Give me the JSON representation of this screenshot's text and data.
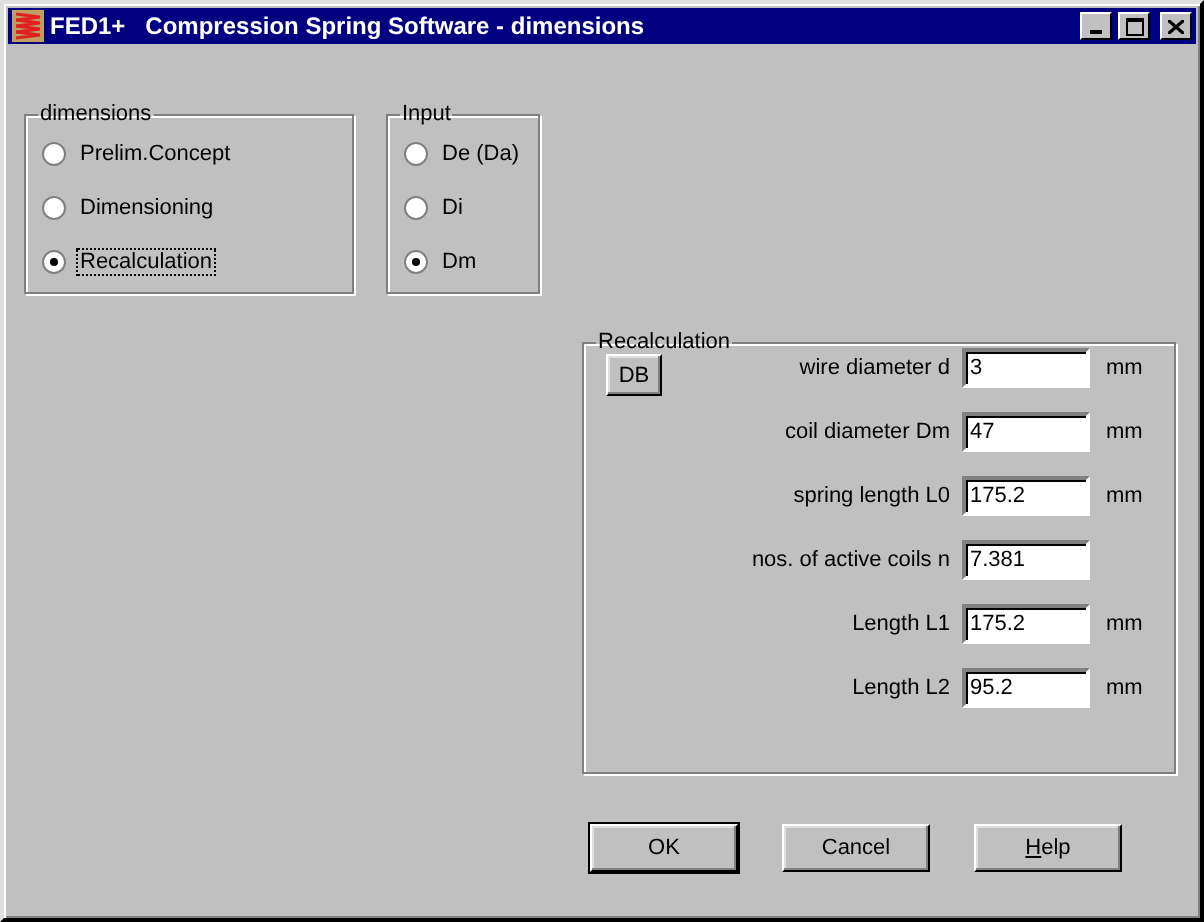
{
  "window": {
    "title": "FED1+   Compression Spring Software - dimensions"
  },
  "dimensions_group": {
    "title": "dimensions",
    "options": [
      {
        "label": "Prelim.Concept",
        "selected": false,
        "focused": false
      },
      {
        "label": "Dimensioning",
        "selected": false,
        "focused": false
      },
      {
        "label": "Recalculation",
        "selected": true,
        "focused": true
      }
    ]
  },
  "input_group": {
    "title": "Input",
    "options": [
      {
        "label": "De (Da)",
        "selected": false
      },
      {
        "label": "Di",
        "selected": false
      },
      {
        "label": "Dm",
        "selected": true
      }
    ]
  },
  "recalculation_group": {
    "title": "Recalculation",
    "db_button": "DB",
    "fields": [
      {
        "label": "wire diameter d",
        "value": "3",
        "unit": "mm"
      },
      {
        "label": "coil diameter Dm",
        "value": "47",
        "unit": "mm"
      },
      {
        "label": "spring length L0",
        "value": "175.2",
        "unit": "mm"
      },
      {
        "label": "nos. of active coils n",
        "value": "7.381"
      },
      {
        "label": "Length L1",
        "value": "175.2",
        "unit": "mm"
      },
      {
        "label": "Length L2",
        "value": "95.2",
        "unit": "mm"
      }
    ]
  },
  "buttons": [
    {
      "label": "OK",
      "default": true,
      "mnemonic": false
    },
    {
      "label": "Cancel",
      "default": false,
      "mnemonic": false
    },
    {
      "label": "Help",
      "default": false,
      "mnemonic": true
    }
  ]
}
